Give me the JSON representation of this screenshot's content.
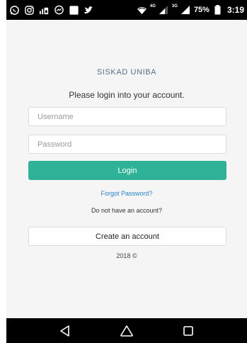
{
  "status_bar": {
    "icons": [
      "whatsapp-icon",
      "instagram-icon",
      "signal-meter-icon",
      "messenger-icon",
      "square-notification-icon",
      "twitter-icon",
      "wifi-icon",
      "signal-4g-icon",
      "signal-3g-icon",
      "battery-icon"
    ],
    "network_1": "4G",
    "network_2": "3G",
    "battery": "75%",
    "time": "3:19"
  },
  "login": {
    "title": "SISKAD UNIBA",
    "subtitle": "Please login into your account.",
    "username_placeholder": "Username",
    "password_placeholder": "Password",
    "login_button": "Login",
    "forgot_password": "Forgot Password?",
    "no_account_text": "Do not have an account?",
    "create_account_button": "Create an account",
    "footer": "2018 ©"
  },
  "navigation": {
    "icons": [
      "back-icon",
      "home-icon",
      "recents-icon"
    ]
  },
  "colors": {
    "primary": "#2fb297",
    "link": "#2a82c7",
    "title": "#5a6d86",
    "background": "#f5f5f5"
  }
}
